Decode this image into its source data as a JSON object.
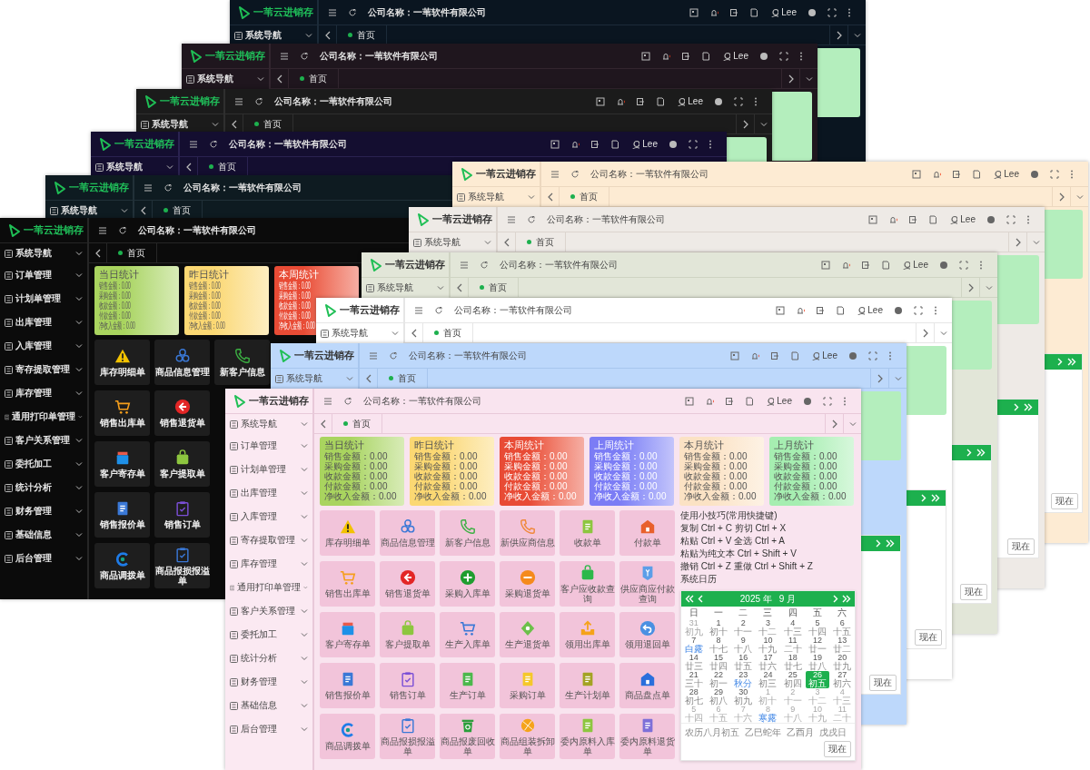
{
  "windows": [
    {
      "kind": "navy",
      "logo": "一苇云进销存",
      "company": "公司名称：一苇软件有限公司",
      "user": "Lee",
      "nav": [
        {
          "label": "系统导航"
        }
      ],
      "tabs": [
        {
          "label": "首页",
          "selected": true
        }
      ],
      "tab_buttons": true,
      "peek": {
        "color": "#b4eebd"
      }
    },
    {
      "kind": "plum",
      "logo": "一苇云进销存",
      "company": "公司名称：一苇软件有限公司",
      "user": "Lee",
      "nav": [
        {
          "label": "系统导航"
        }
      ],
      "tabs": [
        {
          "label": "首页",
          "selected": true
        }
      ],
      "tab_buttons": true,
      "peek": {
        "color": "#b4eebd"
      }
    },
    {
      "kind": "charcoal",
      "logo": "一苇云进销存",
      "company": "公司名称：一苇软件有限公司",
      "user": "Lee",
      "nav": [
        {
          "label": "系统导航"
        }
      ],
      "tabs": [
        {
          "label": "首页",
          "selected": true
        }
      ],
      "tab_buttons": true,
      "peek": {
        "color": "#b4eebd"
      }
    },
    {
      "kind": "indigo",
      "logo": "一苇云进销存",
      "company": "公司名称：一苇软件有限公司",
      "user": "Lee",
      "nav": [
        {
          "label": "系统导航"
        }
      ],
      "tabs": [
        {
          "label": "首页",
          "selected": true
        }
      ]
    },
    {
      "kind": "slate",
      "logo": "一苇云进销存",
      "company": "公司名称：一苇软件有限公司",
      "nav": [
        {
          "label": "系统导航"
        }
      ],
      "tabs": [
        {
          "label": "首页",
          "selected": true
        }
      ]
    },
    {
      "kind": "black",
      "logo": "一苇云进销存",
      "company": "公司名称：一苇软件有限公司",
      "nav": [
        {
          "label": "系统导航"
        },
        {
          "label": "订单管理"
        },
        {
          "label": "计划单管理"
        },
        {
          "label": "出库管理"
        },
        {
          "label": "入库管理"
        },
        {
          "label": "寄存提取管理"
        },
        {
          "label": "库存管理"
        },
        {
          "label": "通用打印单管理"
        },
        {
          "label": "客户关系管理"
        },
        {
          "label": "委托加工"
        },
        {
          "label": "统计分析"
        },
        {
          "label": "财务管理"
        },
        {
          "label": "基础信息"
        },
        {
          "label": "后台管理"
        }
      ],
      "tabs": [
        {
          "label": "首页",
          "selected": true
        }
      ],
      "stats": [
        {
          "title": "当日统计",
          "color": "#a9d45f",
          "lines": [
            "销售金额：0.00",
            "采购金额：0.00",
            "收款金额：0.00",
            "付款金额：0.00",
            "净收入金额：0.00"
          ]
        },
        {
          "title": "昨日统计",
          "color": "#fbd873",
          "lines": [
            "销售金额：0.00",
            "采购金额：0.00",
            "收款金额：0.00",
            "付款金额：0.00",
            "净收入金额：0.00"
          ]
        },
        {
          "title": "本周统计",
          "color": "#e84b35",
          "lines": [
            "销售金额：0.00",
            "采购金额：0.00",
            "收款金额：0.00",
            "付款金额：0.00",
            "净收入金额：0.00"
          ]
        }
      ],
      "tiles": [
        [
          {
            "label": "库存明细单",
            "kind": "warning",
            "color": "#f2c200"
          },
          {
            "label": "商品信息管理",
            "kind": "cubes",
            "color": "#3a78d6"
          },
          {
            "label": "新客户信息",
            "kind": "phone",
            "color": "#3cb043"
          }
        ],
        [
          {
            "label": "销售出库单",
            "kind": "cart",
            "color": "#f59e1b"
          },
          {
            "label": "销售退货单",
            "kind": "back",
            "color": "#e32626"
          }
        ],
        [
          {
            "label": "客户寄存单",
            "kind": "box",
            "color": "#1e90e8"
          },
          {
            "label": "客户提取单",
            "kind": "bag",
            "color": "#8dc63f"
          }
        ],
        [
          {
            "label": "销售报价单",
            "kind": "doc",
            "color": "#3a78d6"
          },
          {
            "label": "销售订单",
            "kind": "clipboard",
            "color": "#7b4fd6"
          }
        ],
        [
          {
            "label": "商品调拨单",
            "kind": "ring",
            "color": "#1e7ce8"
          },
          {
            "label": "商品报损报溢单",
            "kind": "clipboard",
            "color": "#3a78d6"
          }
        ]
      ]
    },
    {
      "kind": "cream",
      "logo": "一苇云进销存",
      "company": "公司名称：一苇软件有限公司",
      "user": "Lee",
      "nav": [
        {
          "label": "系统导航"
        }
      ],
      "tabs": [
        {
          "label": "首页",
          "selected": true
        }
      ],
      "tab_buttons": true,
      "peek": {
        "color": "#b4eebd",
        "now_button": "现在"
      }
    },
    {
      "kind": "stone",
      "logo": "一苇云进销存",
      "company": "公司名称：一苇软件有限公司",
      "user": "Lee",
      "nav": [
        {
          "label": "系统导航"
        }
      ],
      "tabs": [
        {
          "label": "首页",
          "selected": true
        }
      ],
      "tab_buttons": true,
      "peek": {
        "color": "#b4eebd",
        "now_button": "现在"
      }
    },
    {
      "kind": "sage",
      "logo": "一苇云进销存",
      "company": "公司名称：一苇软件有限公司",
      "user": "Lee",
      "nav": [
        {
          "label": "系统导航"
        }
      ],
      "tabs": [
        {
          "label": "首页",
          "selected": true
        }
      ],
      "tab_buttons": true,
      "peek": {
        "color": "#b4eebd",
        "now_button": "现在"
      }
    },
    {
      "kind": "white",
      "logo": "一苇云进销存",
      "company": "公司名称：一苇软件有限公司",
      "user": "Lee",
      "nav": [
        {
          "label": "系统导航"
        }
      ],
      "tabs": [
        {
          "label": "首页",
          "selected": true
        }
      ],
      "tab_buttons": true,
      "peek": {
        "color": "#b4eebd",
        "now_button": "现在"
      }
    },
    {
      "kind": "sky",
      "logo": "一苇云进销存",
      "company": "公司名称：一苇软件有限公司",
      "user": "Lee",
      "nav": [
        {
          "label": "系统导航"
        }
      ],
      "tabs": [
        {
          "label": "首页",
          "selected": true
        }
      ],
      "tab_buttons": true,
      "peek": {
        "color": "#b4eebd",
        "now_button": "现在"
      }
    },
    {
      "kind": "pink",
      "logo": "一苇云进销存",
      "company": "公司名称：一苇软件有限公司",
      "user": "Lee",
      "nav": [
        {
          "label": "系统导航"
        },
        {
          "label": "订单管理"
        },
        {
          "label": "计划单管理"
        },
        {
          "label": "出库管理"
        },
        {
          "label": "入库管理"
        },
        {
          "label": "寄存提取管理"
        },
        {
          "label": "库存管理"
        },
        {
          "label": "通用打印单管理"
        },
        {
          "label": "客户关系管理"
        },
        {
          "label": "委托加工"
        },
        {
          "label": "统计分析"
        },
        {
          "label": "财务管理"
        },
        {
          "label": "基础信息"
        },
        {
          "label": "后台管理"
        }
      ],
      "tabs": [
        {
          "label": "首页",
          "selected": true
        }
      ],
      "tab_buttons": true,
      "stats": [
        {
          "title": "当日统计",
          "color": "#a9d45f",
          "lines": [
            "销售金额：0.00",
            "采购金额：0.00",
            "收款金额：0.00",
            "付款金额：0.00",
            "净收入金额：0.00"
          ]
        },
        {
          "title": "昨日统计",
          "color": "#fbd873",
          "lines": [
            "销售金额：0.00",
            "采购金额：0.00",
            "收款金额：0.00",
            "付款金额：0.00",
            "净收入金额：0.00"
          ]
        },
        {
          "title": "本周统计",
          "color": "#e84b35",
          "lines": [
            "销售金额：0.00",
            "采购金额：0.00",
            "收款金额：0.00",
            "付款金额：0.00",
            "净收入金额：0.00"
          ]
        },
        {
          "title": "上周统计",
          "color": "#7b7cf5",
          "lines": [
            "销售金额：0.00",
            "采购金额：0.00",
            "收款金额：0.00",
            "付款金额：0.00",
            "净收入金额：0.00"
          ]
        },
        {
          "title": "本月统计",
          "color": "#fbe2c4",
          "lines": [
            "销售金额：0.00",
            "采购金额：0.00",
            "收款金额：0.00",
            "付款金额：0.00",
            "净收入金额：0.00"
          ]
        },
        {
          "title": "上月统计",
          "color": "#a6eeb1",
          "lines": [
            "销售金额：0.00",
            "采购金额：0.00",
            "收款金额：0.00",
            "付款金额：0.00",
            "净收入金额：0.00"
          ]
        }
      ],
      "tiles": [
        [
          {
            "label": "库存明细单",
            "kind": "warning",
            "color": "#f2c200"
          },
          {
            "label": "商品信息管理",
            "kind": "cubes",
            "color": "#3a78d6"
          },
          {
            "label": "新客户信息",
            "kind": "phone",
            "color": "#3cb043"
          },
          {
            "label": "新供应商信息",
            "kind": "phone",
            "color": "#f0883a"
          },
          {
            "label": "收款单",
            "kind": "doc",
            "color": "#8dc63f"
          },
          {
            "label": "付款单",
            "kind": "house",
            "color": "#e8602c"
          }
        ],
        [
          {
            "label": "销售出库单",
            "kind": "cart",
            "color": "#f59e1b"
          },
          {
            "label": "销售退货单",
            "kind": "back",
            "color": "#e32626"
          },
          {
            "label": "采购入库单",
            "kind": "plus",
            "color": "#1f9d2f"
          },
          {
            "label": "采购退货单",
            "kind": "minus",
            "color": "#f58a1c"
          },
          {
            "label": "客户应收款查询",
            "kind": "bag",
            "color": "#2db84a"
          },
          {
            "label": "供应商应付款查询",
            "kind": "tag",
            "color": "#5c9ee8"
          }
        ],
        [
          {
            "label": "客户寄存单",
            "kind": "box",
            "color": "#1e90e8"
          },
          {
            "label": "客户提取单",
            "kind": "bag",
            "color": "#8dc63f"
          },
          {
            "label": "生产入库单",
            "kind": "cart",
            "color": "#3a78d6"
          },
          {
            "label": "生产退货单",
            "kind": "diamond",
            "color": "#6cc04a"
          },
          {
            "label": "领用出库单",
            "kind": "upload",
            "color": "#f5a31a"
          },
          {
            "label": "领用退回单",
            "kind": "undo",
            "color": "#4a90e2"
          }
        ],
        [
          {
            "label": "销售报价单",
            "kind": "doc",
            "color": "#3a78d6"
          },
          {
            "label": "销售订单",
            "kind": "clipboard",
            "color": "#7b4fd6"
          },
          {
            "label": "生产订单",
            "kind": "doc",
            "color": "#4cb84c"
          },
          {
            "label": "采购订单",
            "kind": "doc",
            "color": "#f5c82a"
          },
          {
            "label": "生产计划单",
            "kind": "doc",
            "color": "#a3a323"
          },
          {
            "label": "商品盘点单",
            "kind": "house",
            "color": "#2a6fdc"
          }
        ],
        [
          {
            "label": "商品调拨单",
            "kind": "ring",
            "color": "#1e7ce8"
          },
          {
            "label": "商品报损报溢单",
            "kind": "clipboard",
            "color": "#3a78d6"
          },
          {
            "label": "商品报废回收单",
            "kind": "trash",
            "color": "#2a9e3a"
          },
          {
            "label": "商品组装拆卸单",
            "kind": "ball",
            "color": "#f5a31a"
          },
          {
            "label": "委内原料入库单",
            "kind": "doc",
            "color": "#8dc63f"
          },
          {
            "label": "委内原料退货单",
            "kind": "doc",
            "color": "#7d6fd8"
          }
        ]
      ],
      "tips": [
        "使用小技巧(常用快捷键)",
        "复制 Ctrl + C 剪切 Ctrl + X",
        "粘贴 Ctrl + V 全选 Ctrl + A",
        "粘贴为纯文本 Ctrl + Shift + V",
        "撤销 Ctrl + Z 重做 Ctrl + Shift + Z"
      ],
      "calendar_title": "系统日历",
      "calendar": {
        "year": "2025 年",
        "month": "9 月",
        "weekdays": [
          "日",
          "一",
          "二",
          "三",
          "四",
          "五",
          "六"
        ],
        "days": [
          {
            "day": "31",
            "lunar": "初九",
            "other": true,
            "term": false,
            "selected": false
          },
          {
            "day": "1",
            "lunar": "初十",
            "other": false,
            "term": false,
            "selected": false
          },
          {
            "day": "2",
            "lunar": "十一",
            "other": false,
            "term": false,
            "selected": false
          },
          {
            "day": "3",
            "lunar": "十二",
            "other": false,
            "term": false,
            "selected": false
          },
          {
            "day": "4",
            "lunar": "十三",
            "other": false,
            "term": false,
            "selected": false
          },
          {
            "day": "5",
            "lunar": "十四",
            "other": false,
            "term": false,
            "selected": false
          },
          {
            "day": "6",
            "lunar": "十五",
            "other": false,
            "term": false,
            "selected": false
          },
          {
            "day": "7",
            "lunar": "白露",
            "other": false,
            "term": true,
            "selected": false
          },
          {
            "day": "8",
            "lunar": "十七",
            "other": false,
            "term": false,
            "selected": false
          },
          {
            "day": "9",
            "lunar": "十八",
            "other": false,
            "term": false,
            "selected": false
          },
          {
            "day": "10",
            "lunar": "十九",
            "other": false,
            "term": false,
            "selected": false
          },
          {
            "day": "11",
            "lunar": "二十",
            "other": false,
            "term": false,
            "selected": false
          },
          {
            "day": "12",
            "lunar": "廿一",
            "other": false,
            "term": false,
            "selected": false
          },
          {
            "day": "13",
            "lunar": "廿二",
            "other": false,
            "term": false,
            "selected": false
          },
          {
            "day": "14",
            "lunar": "廿三",
            "other": false,
            "term": false,
            "selected": false
          },
          {
            "day": "15",
            "lunar": "廿四",
            "other": false,
            "term": false,
            "selected": false
          },
          {
            "day": "16",
            "lunar": "廿五",
            "other": false,
            "term": false,
            "selected": false
          },
          {
            "day": "17",
            "lunar": "廿六",
            "other": false,
            "term": false,
            "selected": false
          },
          {
            "day": "18",
            "lunar": "廿七",
            "other": false,
            "term": false,
            "selected": false
          },
          {
            "day": "19",
            "lunar": "廿八",
            "other": false,
            "term": false,
            "selected": false
          },
          {
            "day": "20",
            "lunar": "廿九",
            "other": false,
            "term": false,
            "selected": false
          },
          {
            "day": "21",
            "lunar": "三十",
            "other": false,
            "term": false,
            "selected": false
          },
          {
            "day": "22",
            "lunar": "初一",
            "other": false,
            "term": false,
            "selected": false
          },
          {
            "day": "23",
            "lunar": "秋分",
            "other": false,
            "term": true,
            "selected": false
          },
          {
            "day": "24",
            "lunar": "初三",
            "other": false,
            "term": false,
            "selected": false
          },
          {
            "day": "25",
            "lunar": "初四",
            "other": false,
            "term": false,
            "selected": false
          },
          {
            "day": "26",
            "lunar": "初五",
            "other": false,
            "term": false,
            "selected": true
          },
          {
            "day": "27",
            "lunar": "初六",
            "other": false,
            "term": false,
            "selected": false
          },
          {
            "day": "28",
            "lunar": "初七",
            "other": false,
            "term": false,
            "selected": false
          },
          {
            "day": "29",
            "lunar": "初八",
            "other": false,
            "term": false,
            "selected": false
          },
          {
            "day": "30",
            "lunar": "初九",
            "other": false,
            "term": false,
            "selected": false
          },
          {
            "day": "1",
            "lunar": "初十",
            "other": true,
            "term": false,
            "selected": false
          },
          {
            "day": "2",
            "lunar": "十一",
            "other": true,
            "term": false,
            "selected": false
          },
          {
            "day": "3",
            "lunar": "十二",
            "other": true,
            "term": false,
            "selected": false
          },
          {
            "day": "4",
            "lunar": "十三",
            "other": true,
            "term": false,
            "selected": false
          },
          {
            "day": "5",
            "lunar": "十四",
            "other": true,
            "term": false,
            "selected": false
          },
          {
            "day": "6",
            "lunar": "十五",
            "other": true,
            "term": false,
            "selected": false
          },
          {
            "day": "7",
            "lunar": "十六",
            "other": true,
            "term": false,
            "selected": false
          },
          {
            "day": "8",
            "lunar": "寒露",
            "other": true,
            "term": true,
            "selected": false
          },
          {
            "day": "9",
            "lunar": "十八",
            "other": true,
            "term": false,
            "selected": false
          },
          {
            "day": "10",
            "lunar": "十九",
            "other": true,
            "term": false,
            "selected": false
          },
          {
            "day": "11",
            "lunar": "二十",
            "other": true,
            "term": false,
            "selected": false
          }
        ],
        "footer": [
          "农历八月初五",
          "乙巳蛇年",
          "乙酉月",
          "戊戌日"
        ],
        "now_button": "现在"
      }
    }
  ]
}
